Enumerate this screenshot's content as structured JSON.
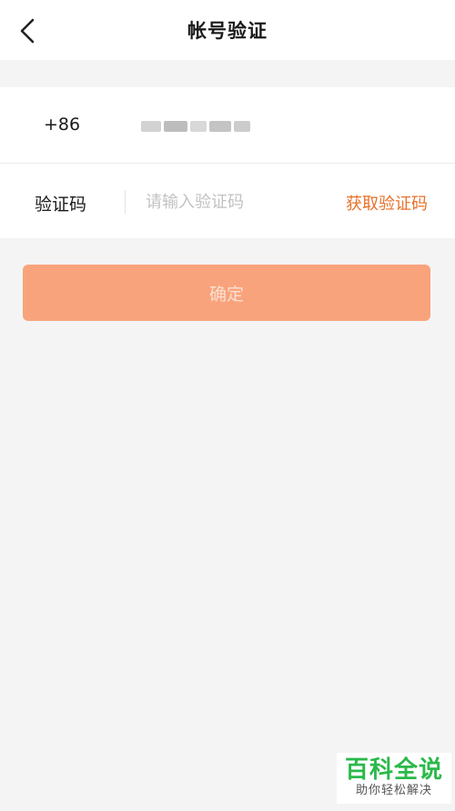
{
  "header": {
    "title": "帐号验证"
  },
  "form": {
    "country_code": "+86",
    "code_label": "验证码",
    "code_placeholder": "请输入验证码",
    "get_code_label": "获取验证码"
  },
  "confirm_label": "确定",
  "watermark": {
    "title": "百科全说",
    "subtitle": "助你轻松解决"
  },
  "colors": {
    "accent": "#e8712a",
    "button": "#f9a37c",
    "background": "#f4f4f4"
  }
}
